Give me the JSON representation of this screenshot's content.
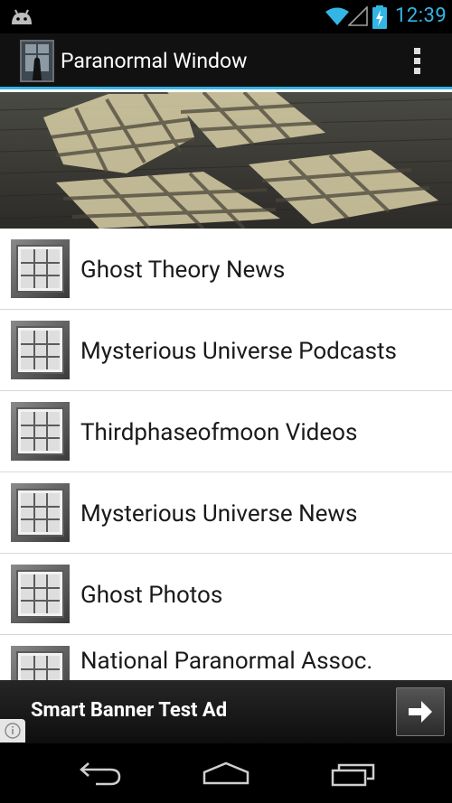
{
  "status_bar": {
    "time": "12:39",
    "icons": [
      "android-notification-icon",
      "wifi-icon",
      "signal-icon",
      "battery-charging-icon"
    ]
  },
  "action_bar": {
    "title": "Paranormal Window",
    "icons": [
      "app-icon",
      "overflow-menu-icon"
    ]
  },
  "feeds": [
    {
      "label": "Ghost Theory News",
      "icon": "window-grid-icon"
    },
    {
      "label": "Mysterious Universe Podcasts",
      "icon": "window-grid-icon"
    },
    {
      "label": "Thirdphaseofmoon Videos",
      "icon": "window-grid-icon"
    },
    {
      "label": "Mysterious Universe News",
      "icon": "window-grid-icon"
    },
    {
      "label": "Ghost Photos",
      "icon": "window-grid-icon"
    },
    {
      "label": "National Paranormal Assoc.",
      "icon": "window-grid-icon"
    }
  ],
  "ad": {
    "text": "Smart Banner Test Ad",
    "icons": [
      "arrow-right-icon",
      "info-icon"
    ]
  },
  "nav_bar": {
    "icons": [
      "back-icon",
      "home-icon",
      "recent-apps-icon"
    ]
  },
  "colors": {
    "accent": "#33b5e5",
    "action_bar": "#111111",
    "list_background": "#ffffff"
  }
}
